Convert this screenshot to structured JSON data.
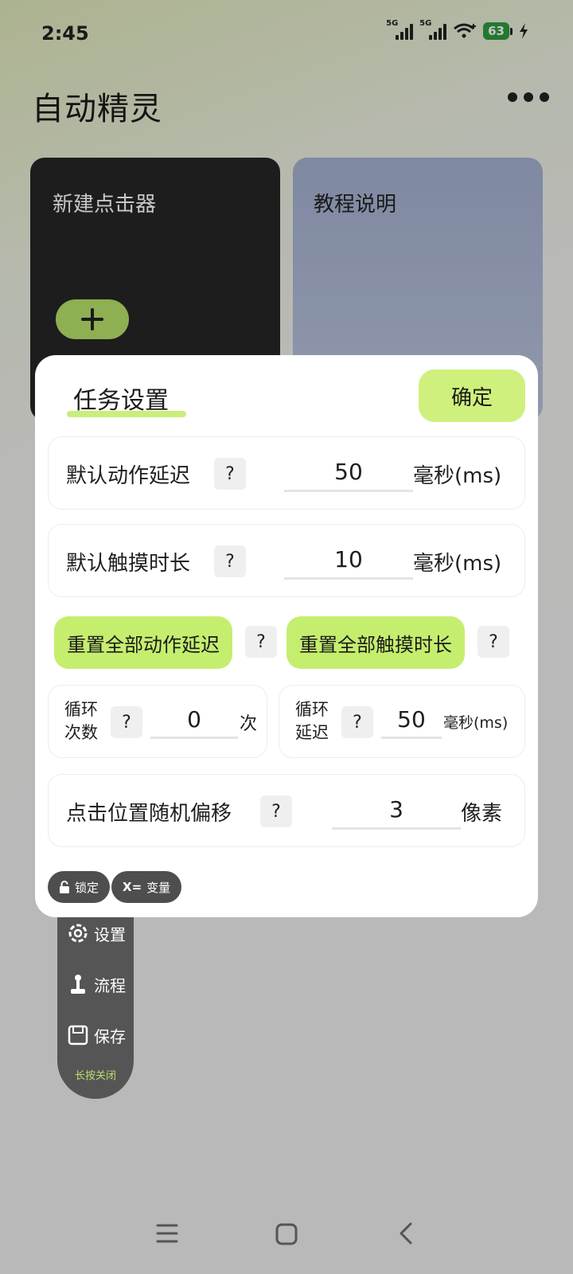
{
  "status": {
    "time": "2:45",
    "signal1": "5G",
    "signal2": "5G",
    "battery": "63"
  },
  "app": {
    "title": "自动精灵"
  },
  "cards": {
    "new_clicker": "新建点击器",
    "tutorial": "教程说明"
  },
  "dialog": {
    "title": "任务设置",
    "confirm": "确定",
    "default_delay": {
      "label": "默认动作延迟",
      "help": "?",
      "value": "50",
      "unit": "毫秒(ms)"
    },
    "default_touch": {
      "label": "默认触摸时长",
      "help": "?",
      "value": "10",
      "unit": "毫秒(ms)"
    },
    "reset_delay": {
      "label": "重置全部动作延迟",
      "help": "?"
    },
    "reset_touch": {
      "label": "重置全部触摸时长",
      "help": "?"
    },
    "loop_count": {
      "label": "循环次数",
      "help": "?",
      "value": "0",
      "unit": "次"
    },
    "loop_delay": {
      "label": "循环延迟",
      "help": "?",
      "value": "50",
      "unit": "毫秒(ms)"
    },
    "random_offset": {
      "label": "点击位置随机偏移",
      "help": "?",
      "value": "3",
      "unit": "像素"
    },
    "chips": {
      "lock": "锁定",
      "variable_prefix": "X=",
      "variable": "变量"
    }
  },
  "toolbar": {
    "settings": "设置",
    "flow": "流程",
    "save": "保存",
    "close_hint": "长按关闭"
  }
}
